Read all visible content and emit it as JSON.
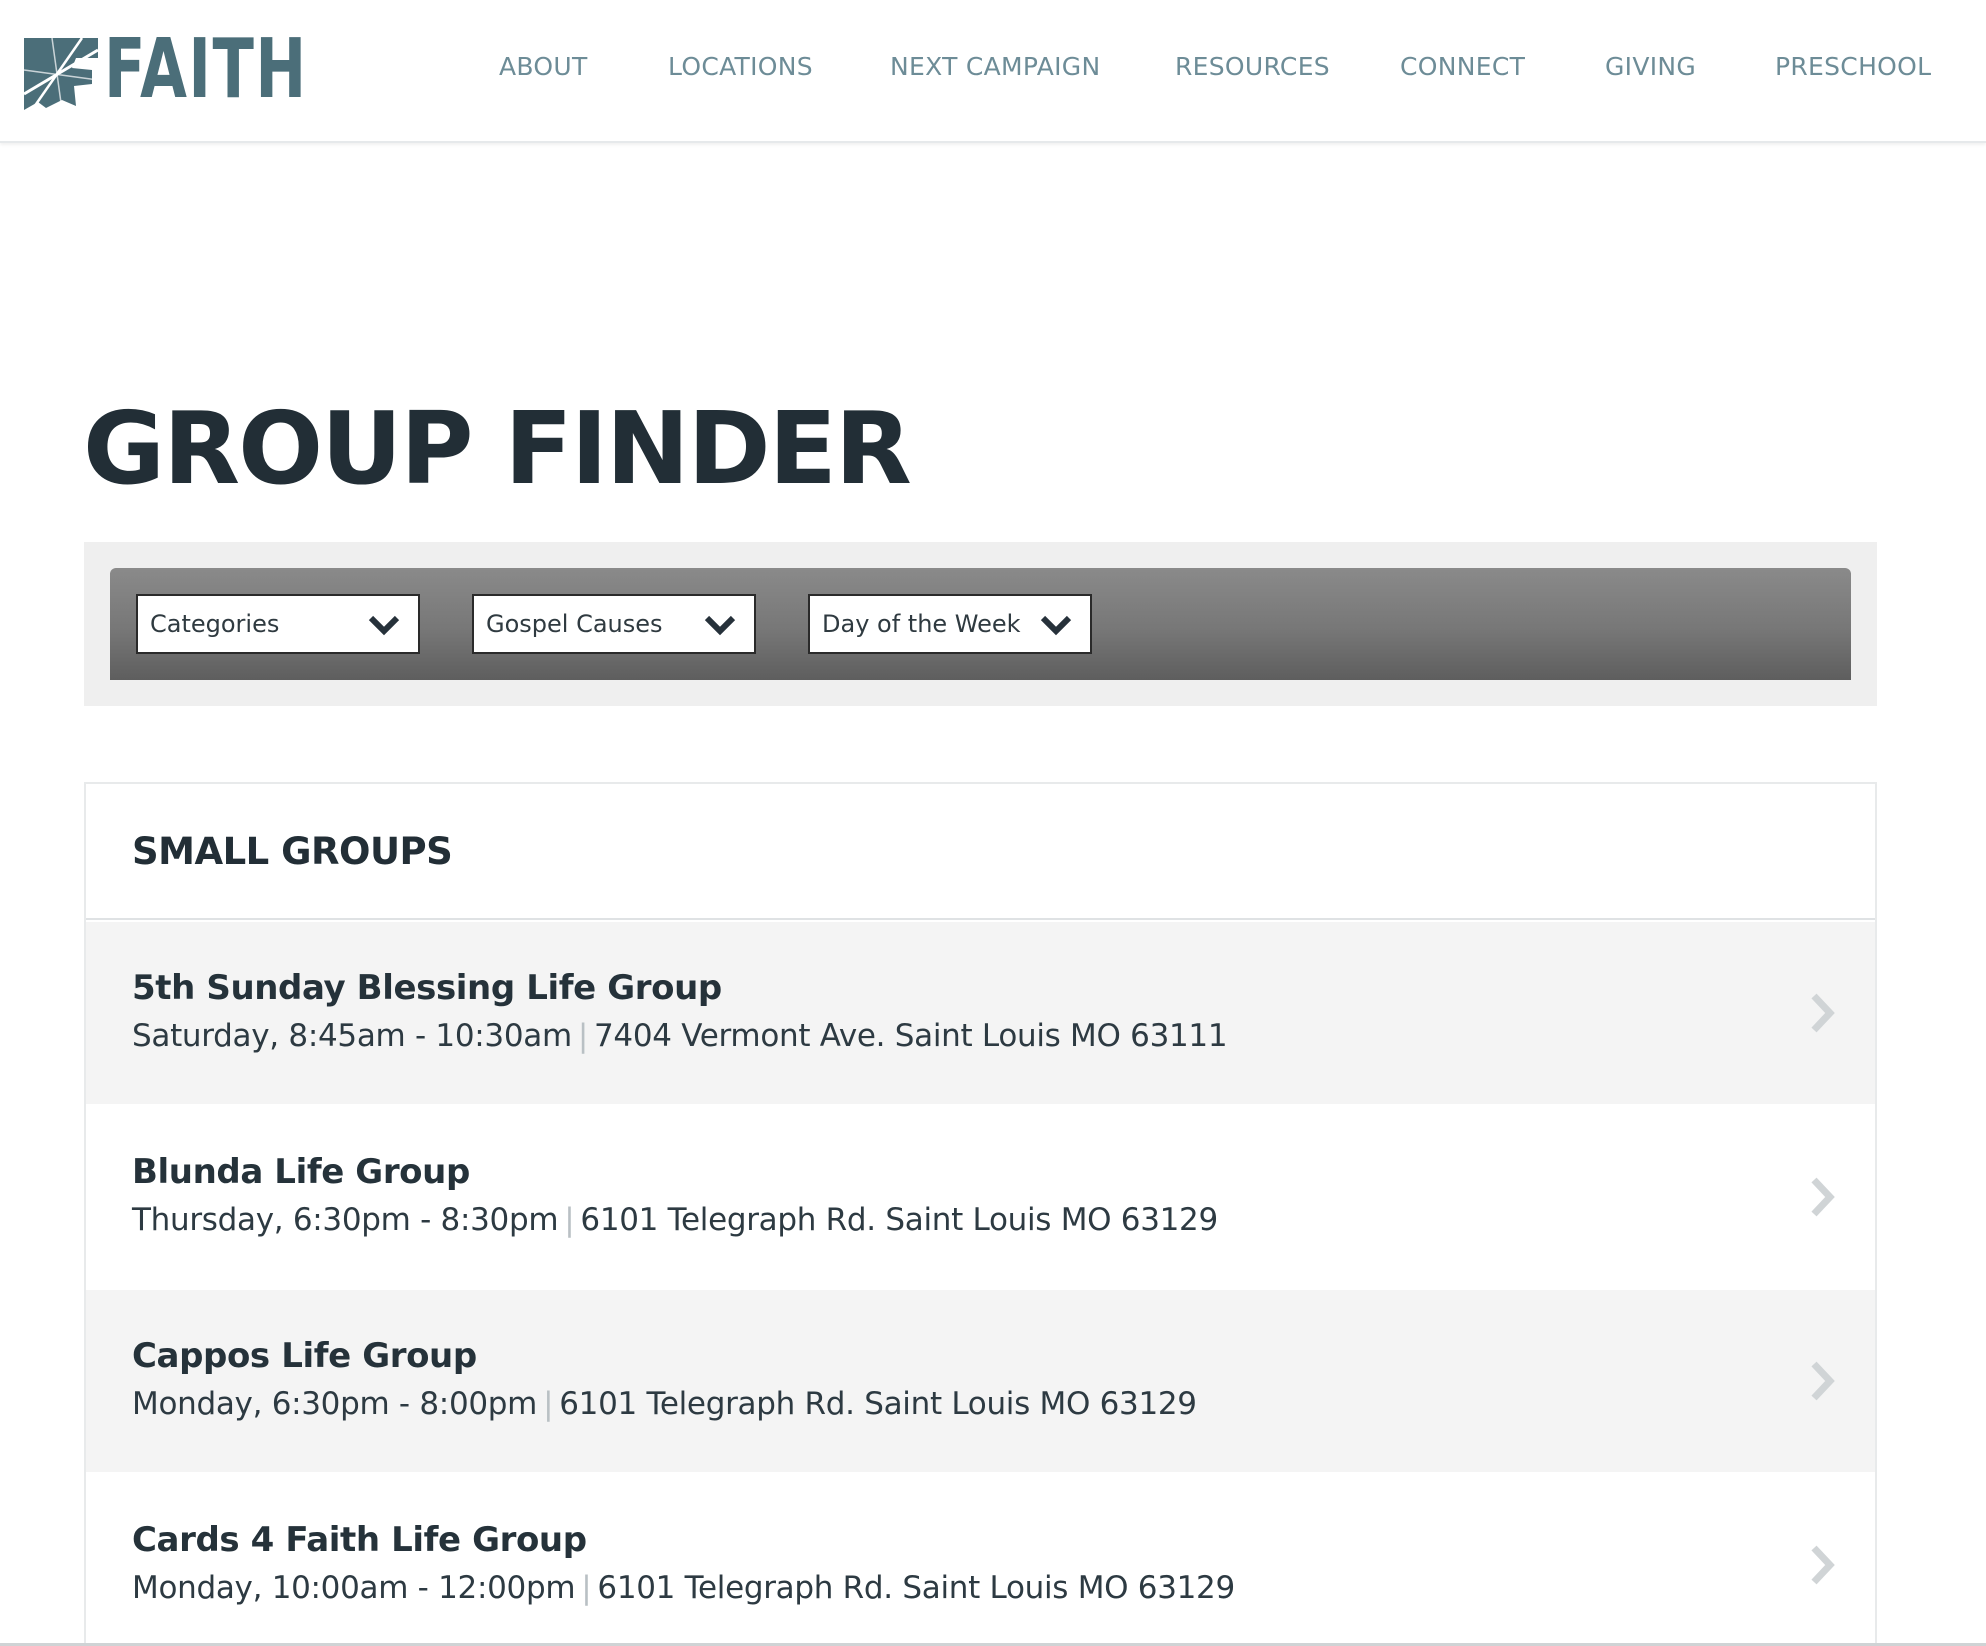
{
  "brand": {
    "name": "FAITH",
    "color": "#4b6e79"
  },
  "nav": {
    "items": [
      {
        "label": "ABOUT"
      },
      {
        "label": "LOCATIONS"
      },
      {
        "label": "NEXT CAMPAIGN"
      },
      {
        "label": "RESOURCES"
      },
      {
        "label": "CONNECT"
      },
      {
        "label": "GIVING"
      },
      {
        "label": "PRESCHOOL"
      }
    ]
  },
  "page": {
    "title": "GROUP FINDER"
  },
  "filters": [
    {
      "label": "Categories",
      "icon": "chevron-down-icon"
    },
    {
      "label": "Gospel Causes",
      "icon": "chevron-down-icon"
    },
    {
      "label": "Day of the Week",
      "icon": "chevron-down-icon"
    }
  ],
  "groups": {
    "section_title": "SMALL GROUPS",
    "separator": "|",
    "items": [
      {
        "name": "5th Sunday Blessing Life Group",
        "schedule": "Saturday, 8:45am - 10:30am",
        "address": "7404 Vermont Ave. Saint Louis MO 63111"
      },
      {
        "name": "Blunda Life Group",
        "schedule": "Thursday, 6:30pm - 8:30pm",
        "address": "6101 Telegraph Rd. Saint Louis MO 63129"
      },
      {
        "name": "Cappos Life Group",
        "schedule": "Monday, 6:30pm - 8:00pm",
        "address": "6101 Telegraph Rd. Saint Louis MO 63129"
      },
      {
        "name": "Cards 4 Faith Life Group",
        "schedule": "Monday, 10:00am - 12:00pm",
        "address": "6101 Telegraph Rd. Saint Louis MO 63129"
      }
    ]
  },
  "colors": {
    "nav_text": "#6d8c97",
    "heading": "#222e36",
    "row_alt_bg": "#f4f4f4",
    "filter_bar": "#777777"
  }
}
